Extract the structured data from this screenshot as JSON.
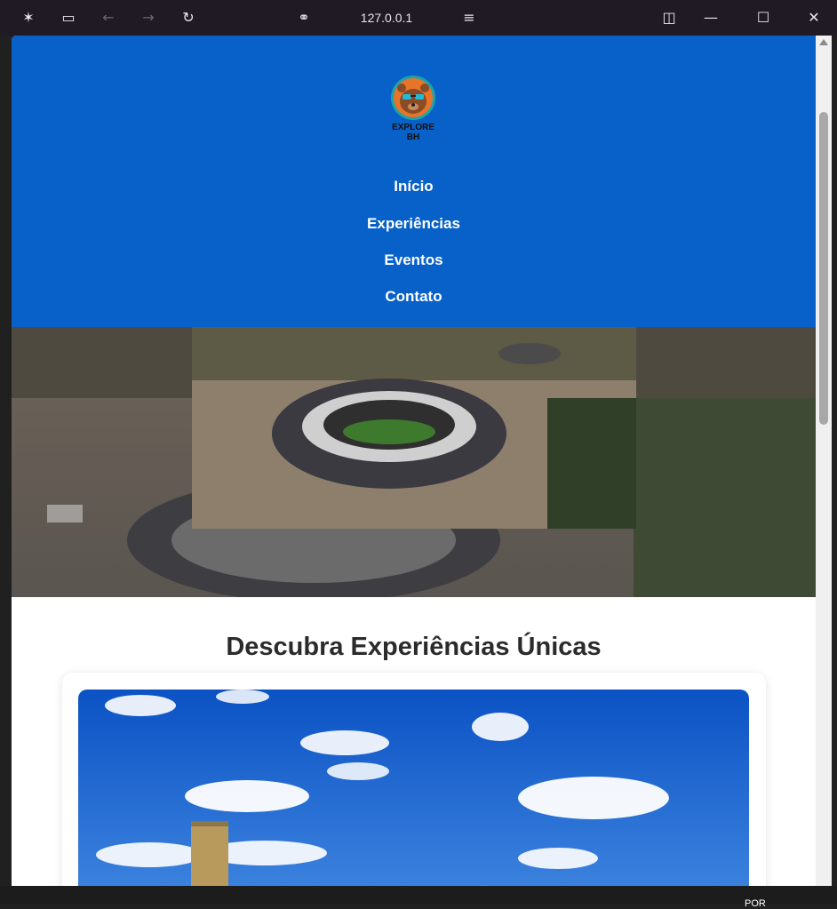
{
  "browser": {
    "url": "127.0.0.1",
    "icons": [
      "app-icon",
      "sidebar-icon",
      "back-icon",
      "forward-icon",
      "reload-icon",
      "link-icon",
      "tune-icon",
      "split-icon",
      "minimize-icon",
      "maximize-icon",
      "close-icon"
    ]
  },
  "site": {
    "logo_text": "EXPLORE BH",
    "nav": [
      "Início",
      "Experiências",
      "Eventos",
      "Contato"
    ],
    "section_title": "Descubra Experiências Únicas"
  },
  "taskbar": {
    "lang": "POR"
  },
  "colors": {
    "header_bg": "#0761c8",
    "card_bg": "#ffffff",
    "title": "#2b2b2b"
  }
}
